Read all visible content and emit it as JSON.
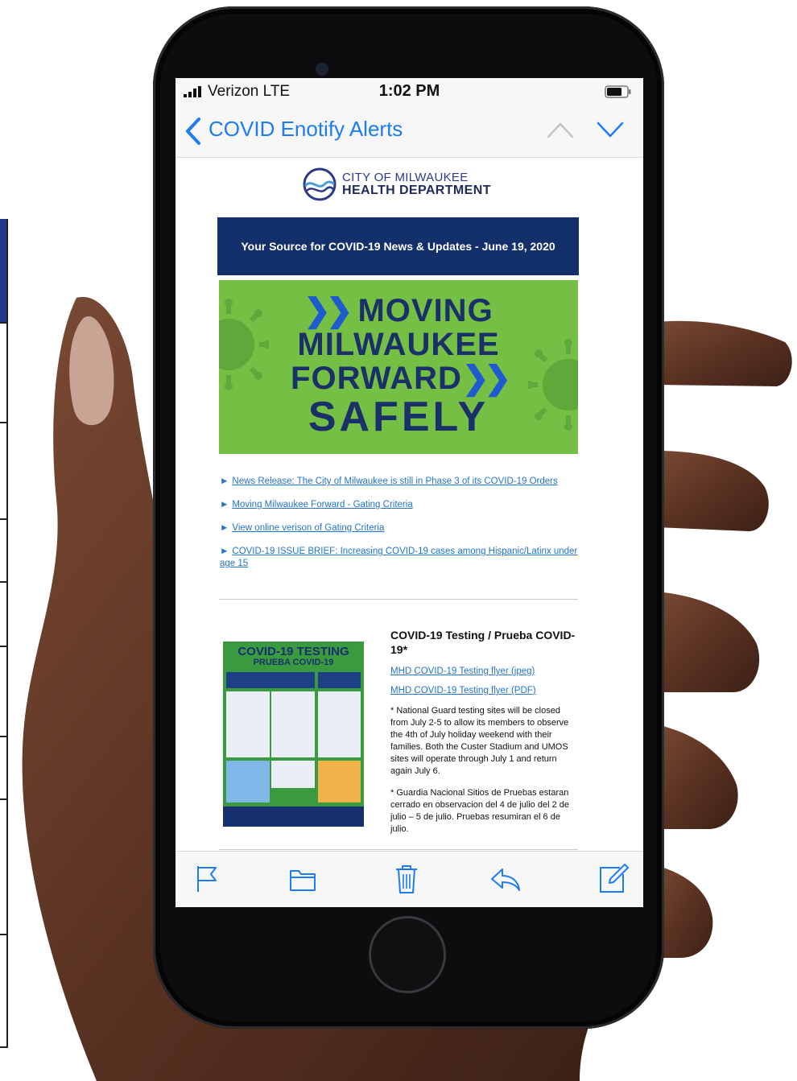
{
  "status_bar": {
    "carrier": "Verizon  LTE",
    "time": "1:02 PM"
  },
  "nav": {
    "back_label": "COVID Enotify Alerts"
  },
  "email": {
    "logo_line1": "CITY OF MILWAUKEE",
    "logo_line2": "HEALTH DEPARTMENT",
    "banner_text": "Your Source for COVID-19 News & Updates - June 19, 2020",
    "hero": {
      "line1": "MOVING",
      "line2": "MILWAUKEE",
      "line3": "FORWARD",
      "line4": "SAFELY"
    },
    "links": [
      "News Release: The City of Milwaukee is still in Phase 3 of its COVID-19 Orders",
      "Moving Milwaukee Forward - Gating Criteria",
      "View online verison of Gating Criteria",
      "COVID-19 ISSUE BRIEF: Increasing COVID-19 cases among Hispanic/Latinx under age 15"
    ],
    "flyer": {
      "title": "COVID-19 TESTING",
      "subtitle": "PRUEBA COVID-19"
    },
    "testing": {
      "heading": "COVID-19 Testing / Prueba COVID-19*",
      "link_jpeg": "MHD COVID-19 Testing flyer (jpeg)",
      "link_pdf": "MHD COVID-19 Testing flyer (PDF)",
      "note_en": "* National Guard testing sites will be closed from July 2-5 to allow its members to observe the 4th of July holiday weekend with their families. Both the Custer Stadium and UMOS sites will operate through July 1 and return again July 6.",
      "note_es": "* Guardia Nacional Sitios de Pruebas estaran cerrado en observacion del 4 de julio del 2 de julio – 5 de julio. Pruebas resumiran el 6 de julio."
    }
  },
  "toolbar": {
    "icons": [
      "flag-icon",
      "folder-icon",
      "trash-icon",
      "reply-icon",
      "compose-icon"
    ]
  },
  "colors": {
    "ios_blue": "#1e7cf2",
    "banner_navy": "#13306b",
    "hero_green": "#75bf44",
    "link_blue": "#2474c9"
  }
}
